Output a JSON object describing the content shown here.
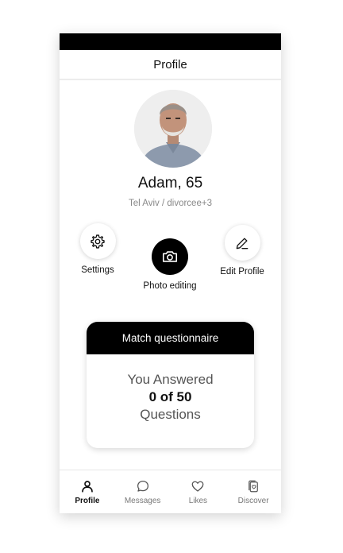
{
  "header": {
    "title": "Profile"
  },
  "profile": {
    "name": "Adam, 65",
    "subtitle": "Tel Aviv / divorcee+3"
  },
  "actions": {
    "settings": {
      "label": "Settings",
      "icon": "gear-icon"
    },
    "photo_editing": {
      "label": "Photo editing",
      "icon": "camera-icon"
    },
    "edit_profile": {
      "label": "Edit Profile",
      "icon": "pencil-icon"
    }
  },
  "questionnaire": {
    "title": "Match questionnaire",
    "line1": "You Answered",
    "line2": "0 of 50",
    "line3": "Questions"
  },
  "tabs": [
    {
      "label": "Profile",
      "icon": "user-icon",
      "active": true
    },
    {
      "label": "Messages",
      "icon": "chat-bubble-icon",
      "active": false
    },
    {
      "label": "Likes",
      "icon": "heart-icon",
      "active": false
    },
    {
      "label": "Discover",
      "icon": "cards-heart-icon",
      "active": false
    }
  ],
  "colors": {
    "primary": "#000000",
    "background": "#ffffff",
    "muted_text": "#888888",
    "active_tab": "#111111",
    "inactive_tab": "#777777"
  }
}
